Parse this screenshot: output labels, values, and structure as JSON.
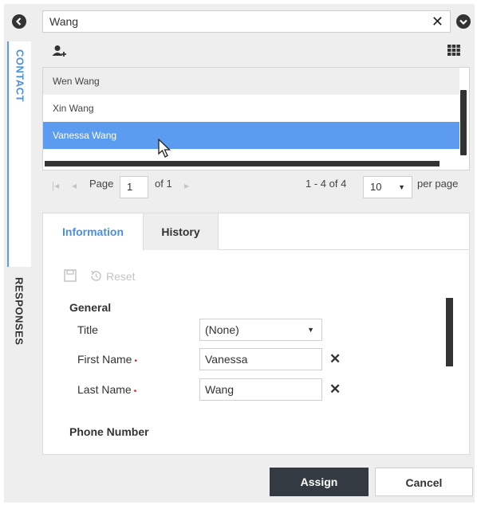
{
  "search": {
    "value": "Wang",
    "clear_glyph": "✕"
  },
  "side_tabs": {
    "contact": "CONTACT",
    "responses": "RESPONSES"
  },
  "icons": {
    "collapse": "chevron-left-circle-icon",
    "dropdown": "chevron-down-circle-icon",
    "add_contact": "add-user-icon",
    "grid": "grid-icon",
    "save": "save-icon",
    "reset": "reset-icon",
    "cursor": "mouse-pointer-icon"
  },
  "results": [
    "Wen Wang",
    "Xin Wang",
    "Vanessa Wang"
  ],
  "selected_result": "Vanessa Wang",
  "pager": {
    "page_label": "Page",
    "page_value": "1",
    "of_label": "of 1",
    "range": "1 - 4 of 4",
    "per_page_value": "10",
    "per_page_label": "per page"
  },
  "tabs": {
    "information": "Information",
    "history": "History"
  },
  "toolbar": {
    "reset_label": "Reset"
  },
  "form": {
    "section_general": "General",
    "title_label": "Title",
    "title_value": "(None)",
    "first_name_label": "First Name",
    "first_name_value": "Vanessa",
    "last_name_label": "Last Name",
    "last_name_value": "Wang",
    "required_mark": "•",
    "section_phone": "Phone Number"
  },
  "buttons": {
    "assign": "Assign",
    "cancel": "Cancel"
  },
  "colors": {
    "accent": "#5b9cf0",
    "required": "#e02020",
    "primary_button": "#333a41"
  }
}
